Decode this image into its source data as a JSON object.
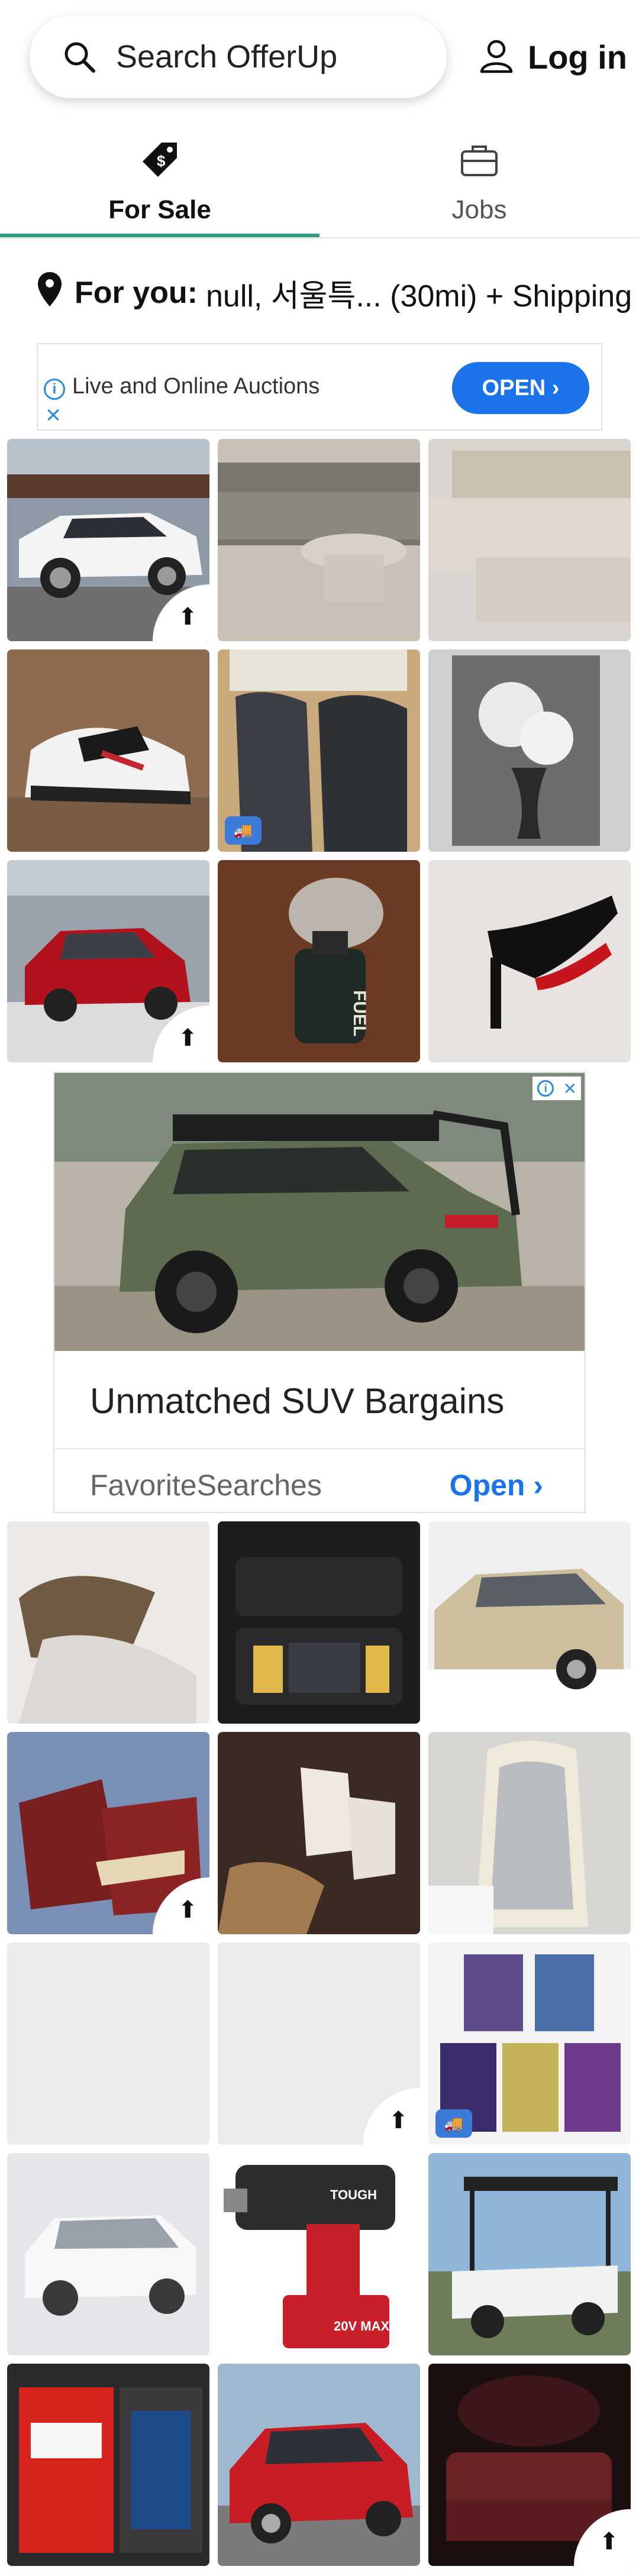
{
  "header": {
    "search_placeholder": "Search OfferUp",
    "login_label": "Log in"
  },
  "tabs": [
    {
      "label": "For Sale",
      "active": true
    },
    {
      "label": "Jobs",
      "active": false
    }
  ],
  "location": {
    "label": "For you:",
    "value": "null, 서울특... (30mi) + Shipping"
  },
  "top_ad": {
    "title": "Live and Online Auctions",
    "button": "OPEN ›"
  },
  "big_ad": {
    "headline": "Unmatched SUV Bargains",
    "advertiser": "FavoriteSearches",
    "cta": "Open ›"
  },
  "product_watermarks": {
    "fuel_bottle": "FUEL",
    "drill_brand": "TOUGH",
    "drill_battery": "20V MAX"
  },
  "colors": {
    "accent_teal": "#2e9c88",
    "ad_blue": "#1a73e8",
    "shipping_badge": "#3d7bd9"
  },
  "icons": {
    "search": "search-icon",
    "user": "user-icon",
    "for_sale": "price-tag-icon",
    "jobs": "briefcase-icon",
    "location": "location-pin-icon",
    "promoted": "bump-arrow-icon",
    "shipping": "truck-icon"
  }
}
